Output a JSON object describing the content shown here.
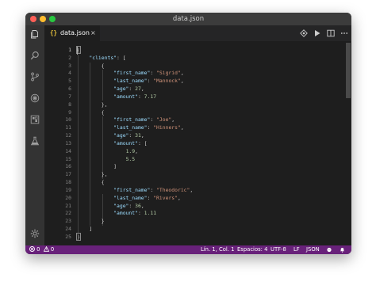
{
  "window": {
    "title": "data.json"
  },
  "activity_bar": {
    "items": [
      {
        "icon": "files-icon"
      },
      {
        "icon": "search-icon"
      },
      {
        "icon": "source-control-icon"
      },
      {
        "icon": "debug-icon"
      },
      {
        "icon": "extensions-icon"
      },
      {
        "icon": "flask-icon"
      }
    ],
    "settings_icon": "gear-icon"
  },
  "tab": {
    "icon_text": "{}",
    "label": "data.json",
    "close": "×"
  },
  "editor_actions": [
    "compare-icon",
    "run-icon",
    "split-editor-icon",
    "more-icon"
  ],
  "editor": {
    "line_numbers": [
      "1",
      "2",
      "3",
      "4",
      "5",
      "6",
      "7",
      "8",
      "9",
      "10",
      "11",
      "12",
      "13",
      "14",
      "15",
      "16",
      "17",
      "18",
      "19",
      "20",
      "21",
      "22",
      "23",
      "24",
      "25"
    ],
    "active_line": "1"
  },
  "status_bar": {
    "errors": "0",
    "warnings": "0",
    "position": "Lín. 1, Col. 1",
    "spaces": "Espacios: 4",
    "encoding": "UTF-8",
    "eol": "LF",
    "language": "JSON",
    "accent_color": "#68217a"
  }
}
